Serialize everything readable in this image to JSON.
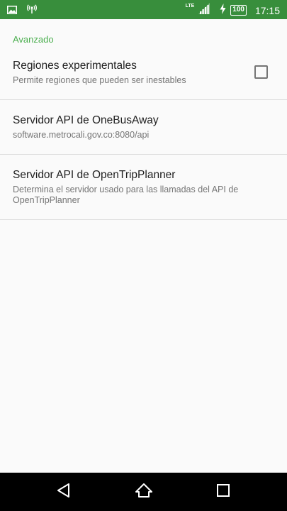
{
  "status_bar": {
    "network_type": "LTE",
    "battery_level": "100",
    "time": "17:15"
  },
  "settings": {
    "category_title": "Avanzado",
    "preferences": [
      {
        "title": "Regiones experimentales",
        "summary": "Permite regiones que pueden ser inestables",
        "checked": false
      },
      {
        "title": "Servidor API de OneBusAway",
        "summary": "software.metrocali.gov.co:8080/api"
      },
      {
        "title": "Servidor API de OpenTripPlanner",
        "summary": "Determina el servidor usado para las llamadas del API de OpenTripPlanner"
      }
    ]
  },
  "navigation_bar": {
    "buttons": [
      "back-icon",
      "home-icon",
      "recents-icon"
    ]
  },
  "colors": {
    "status_bar": "#388e3c",
    "accent": "#4caf50",
    "background": "#fafafa",
    "navigation_bar": "#000000"
  }
}
